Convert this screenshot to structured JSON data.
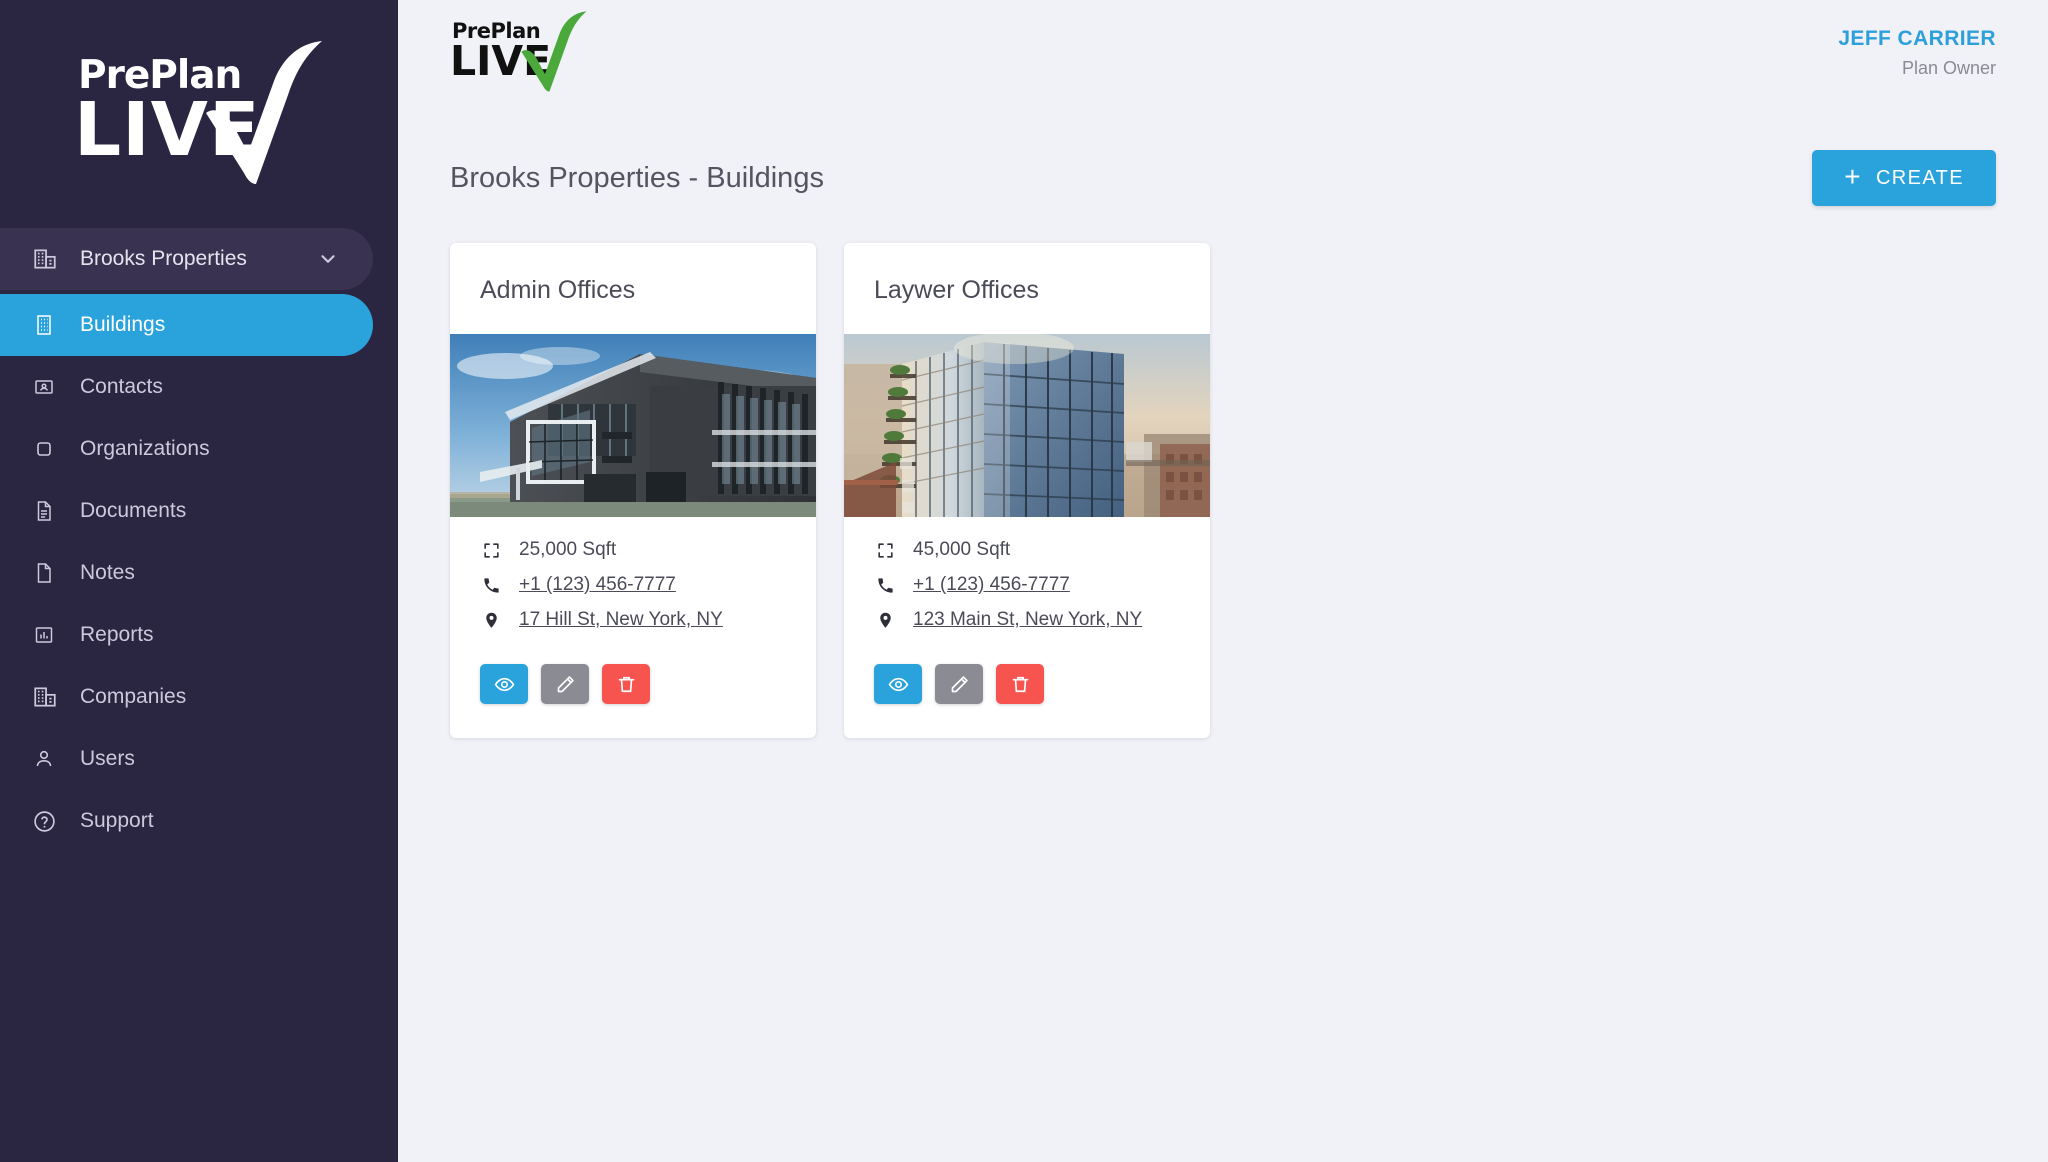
{
  "brand": {
    "name_top": "PrePlan",
    "name_bottom": "LIVE",
    "check_color": "#4aa93a",
    "sidebar_bg": "#2a2540",
    "accent": "#2aa3dd"
  },
  "sidebar": {
    "org": {
      "label": "Brooks Properties",
      "icon": "company-building-icon",
      "chevron": "chevron-down-icon"
    },
    "items": [
      {
        "label": "Buildings",
        "icon": "building-icon",
        "active": true
      },
      {
        "label": "Contacts",
        "icon": "contact-card-icon",
        "active": false
      },
      {
        "label": "Organizations",
        "icon": "organization-icon",
        "active": false
      },
      {
        "label": "Documents",
        "icon": "document-icon",
        "active": false
      },
      {
        "label": "Notes",
        "icon": "note-icon",
        "active": false
      },
      {
        "label": "Reports",
        "icon": "report-chart-icon",
        "active": false
      },
      {
        "label": "Companies",
        "icon": "companies-icon",
        "active": false
      },
      {
        "label": "Users",
        "icon": "user-icon",
        "active": false
      },
      {
        "label": "Support",
        "icon": "help-circle-icon",
        "active": false
      }
    ]
  },
  "header": {
    "user_name": "JEFF CARRIER",
    "user_role": "Plan Owner"
  },
  "page": {
    "title": "Brooks Properties - Buildings",
    "create_label": "CREATE"
  },
  "cards": [
    {
      "title": "Admin Offices",
      "sqft": "25,000 Sqft",
      "phone": "+1 (123) 456-7777",
      "address": "17 Hill St, New York, NY",
      "image_alt": "modern-dark-office-building",
      "actions": {
        "view": "view-button",
        "edit": "edit-button",
        "delete": "delete-button"
      }
    },
    {
      "title": "Laywer Offices",
      "sqft": "45,000 Sqft",
      "phone": "+1 (123) 456-7777",
      "address": "123 Main St, New York, NY",
      "image_alt": "glass-highrise-sunset",
      "actions": {
        "view": "view-button",
        "edit": "edit-button",
        "delete": "delete-button"
      }
    }
  ]
}
